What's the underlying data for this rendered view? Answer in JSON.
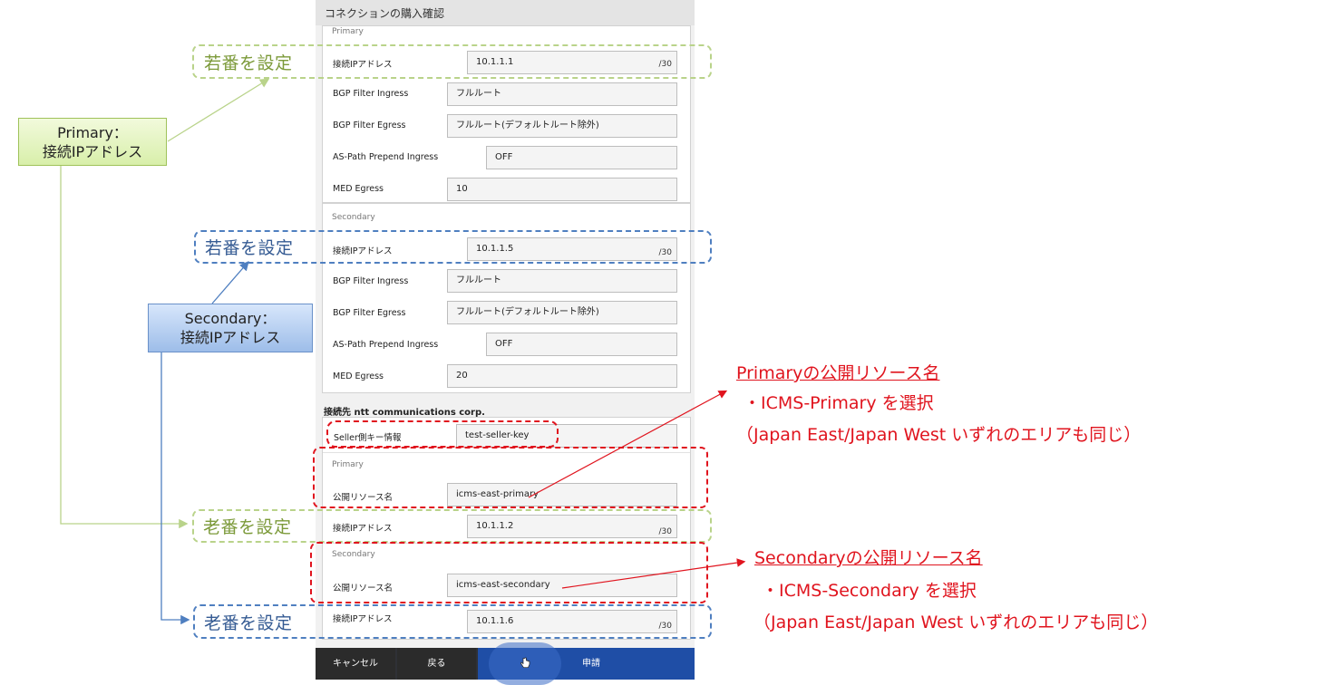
{
  "dialog": {
    "title": "コネクションの購入確認",
    "primary": {
      "section_label": "Primary",
      "fields": [
        {
          "label": "接続IPアドレス",
          "value": "10.1.1.1",
          "suffix": "/30"
        },
        {
          "label": "BGP Filter Ingress",
          "value": "フルルート"
        },
        {
          "label": "BGP Filter Egress",
          "value": "フルルート(デフォルトルート除外)"
        },
        {
          "label": "AS-Path Prepend Ingress",
          "value": "OFF"
        },
        {
          "label": "MED Egress",
          "value": "10"
        }
      ]
    },
    "secondary": {
      "section_label": "Secondary",
      "fields": [
        {
          "label": "接続IPアドレス",
          "value": "10.1.1.5",
          "suffix": "/30"
        },
        {
          "label": "BGP Filter Ingress",
          "value": "フルルート"
        },
        {
          "label": "BGP Filter Egress",
          "value": "フルルート(デフォルトルート除外)"
        },
        {
          "label": "AS-Path Prepend Ingress",
          "value": "OFF"
        },
        {
          "label": "MED Egress",
          "value": "20"
        }
      ]
    },
    "connection": {
      "heading": "接続先 ntt communications corp.",
      "seller_key": {
        "label": "Seller側キー情報",
        "value": "test-seller-key"
      },
      "primary": {
        "section_label": "Primary",
        "resource": {
          "label": "公開リソース名",
          "value": "icms-east-primary"
        },
        "ip": {
          "label": "接続IPアドレス",
          "value": "10.1.1.2",
          "suffix": "/30"
        }
      },
      "secondary": {
        "section_label": "Secondary",
        "resource": {
          "label": "公開リソース名",
          "value": "icms-east-secondary"
        },
        "ip": {
          "label": "接続IPアドレス",
          "value": "10.1.1.6",
          "suffix": "/30"
        }
      }
    },
    "footer": {
      "cancel": "キャンセル",
      "back": "戻る",
      "apply": "申請"
    }
  },
  "annotations": {
    "young_tag": "若番を設定",
    "old_tag": "老番を設定",
    "callout_primary": {
      "line1": "Primary：",
      "line2": "接続IPアドレス"
    },
    "callout_secondary": {
      "line1": "Secondary：",
      "line2": "接続IPアドレス"
    },
    "note_primary": {
      "title": "Primaryの公開リソース名",
      "line1": "・ICMS-Primary を選択",
      "line2": "（Japan East/Japan West いずれのエリアも同じ）"
    },
    "note_secondary": {
      "title": "Secondaryの公開リソース名",
      "line1": "・ICMS-Secondary を選択",
      "line2": "（Japan East/Japan West いずれのエリアも同じ）"
    },
    "colors": {
      "green": "#b9d38a",
      "blue": "#4f7fc0",
      "red": "#e0141e",
      "apply": "#1f4ea6"
    }
  }
}
